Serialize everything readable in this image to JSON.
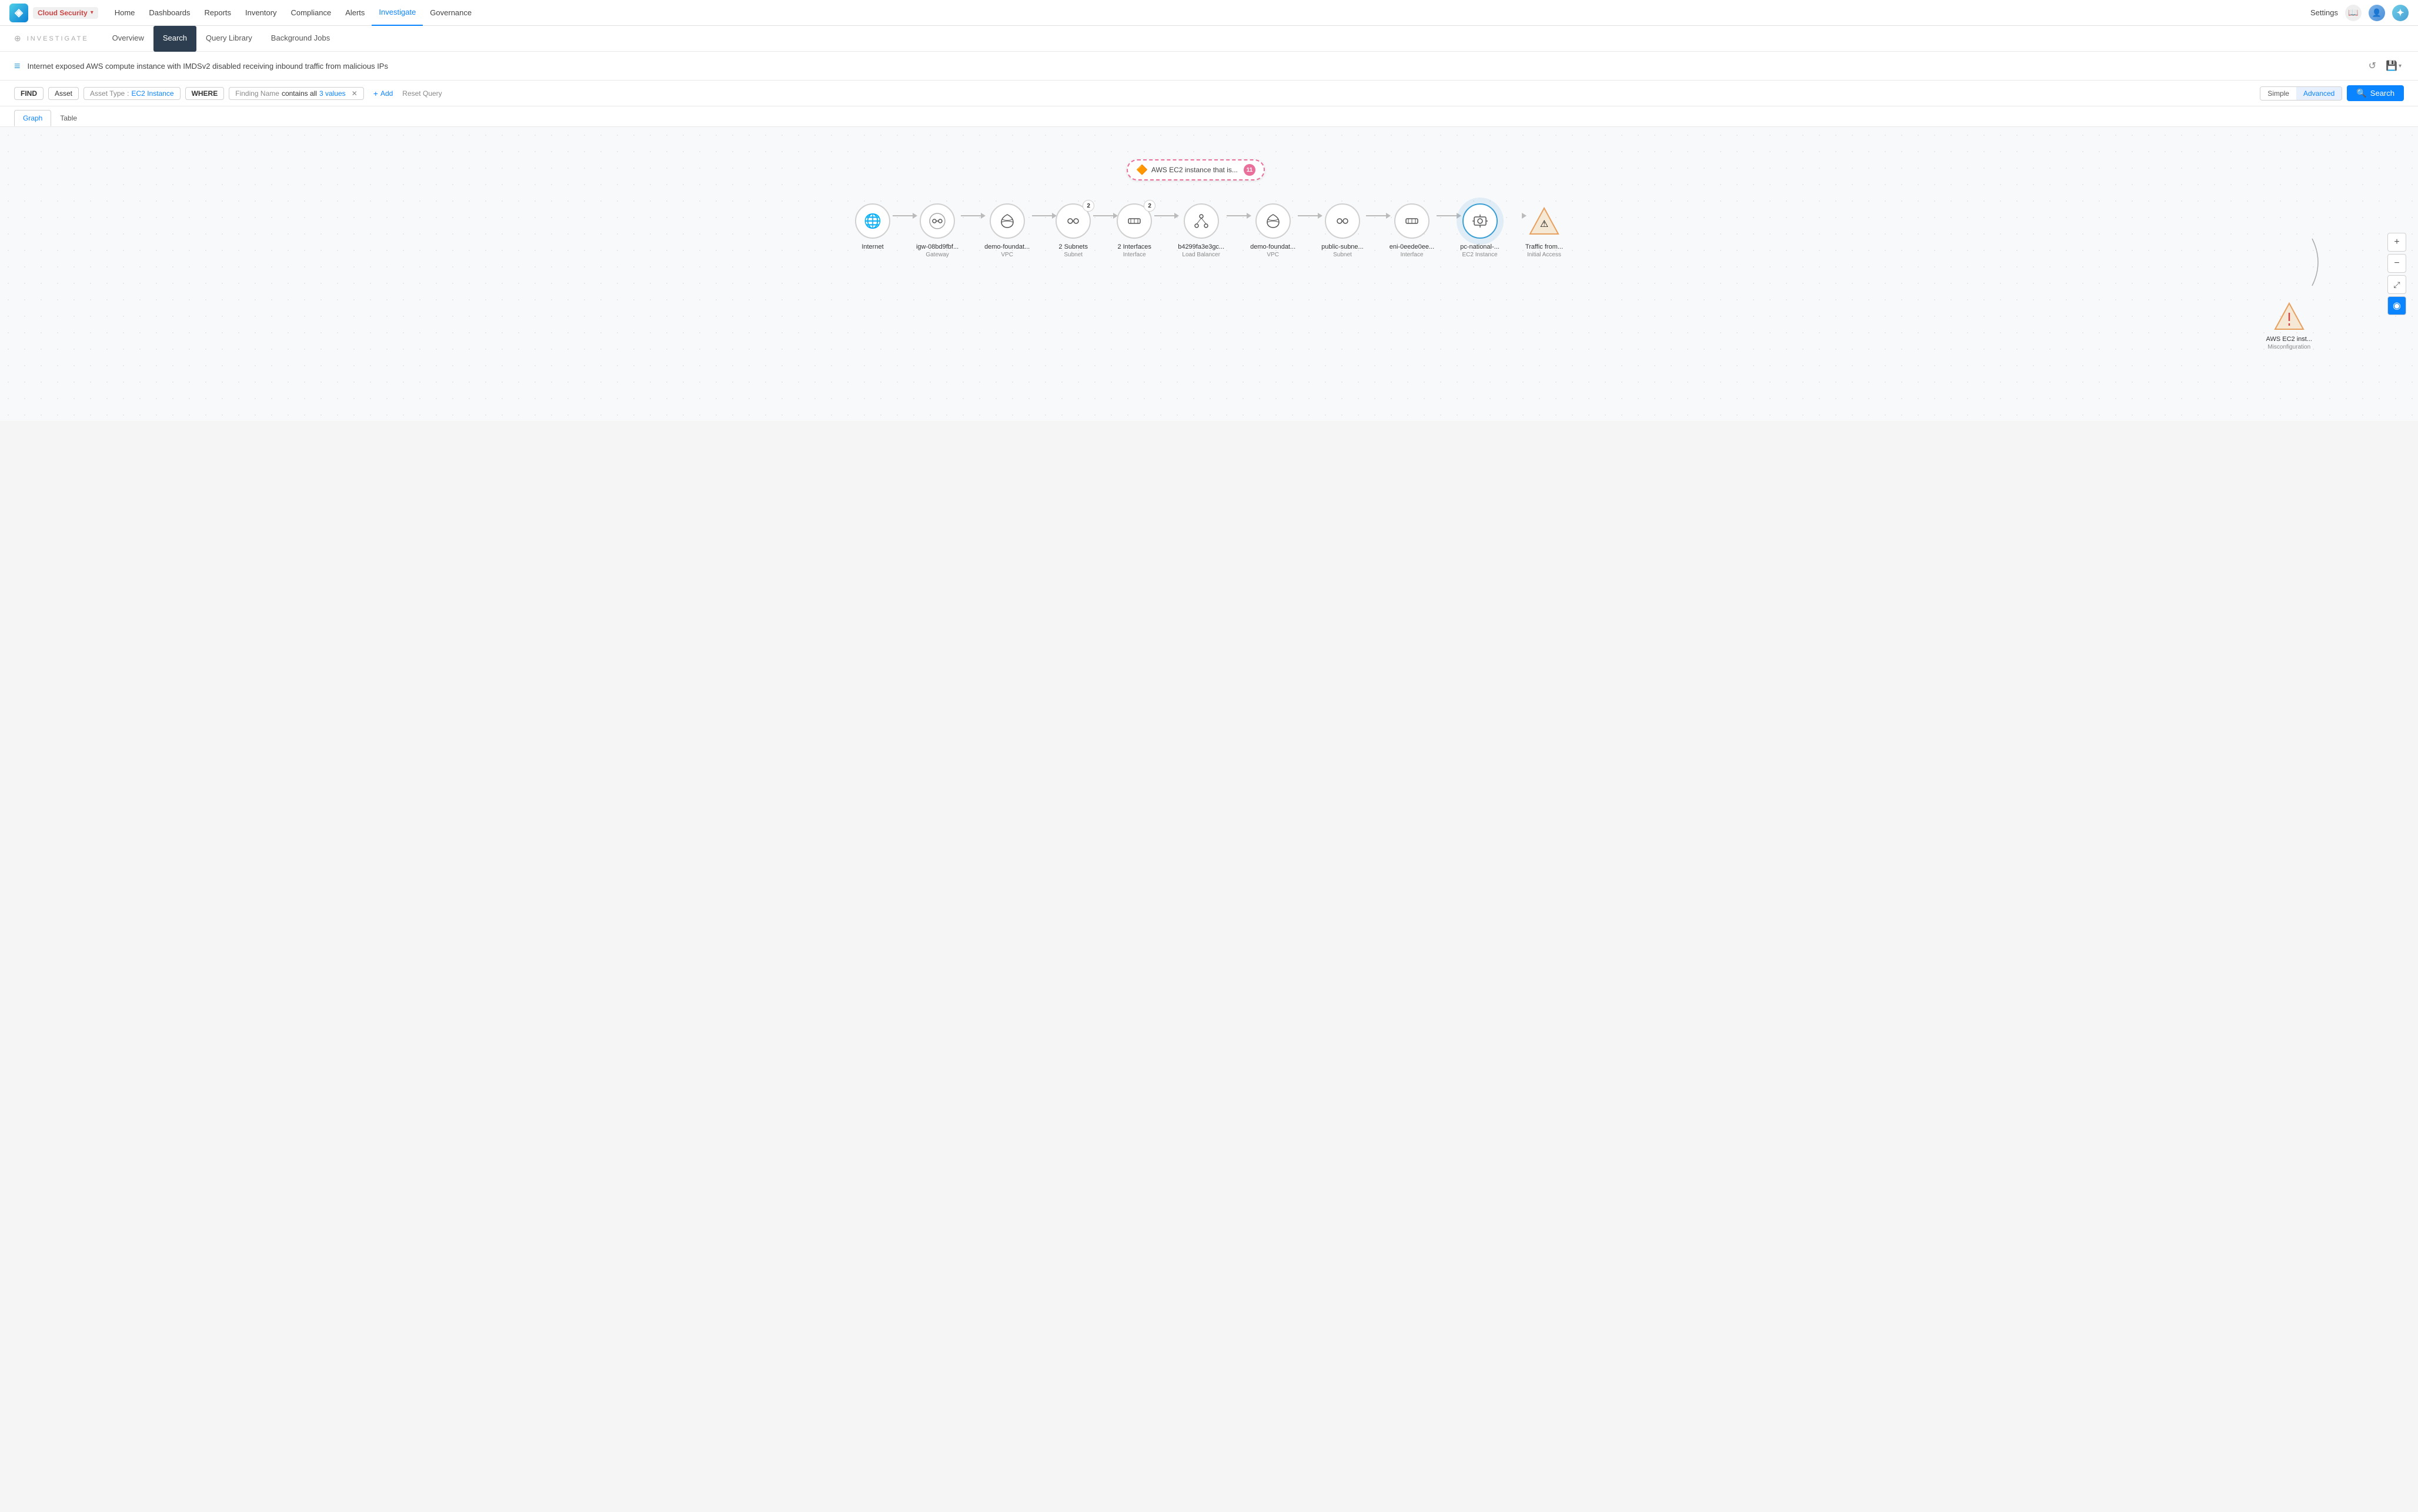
{
  "app": {
    "logo_char": "◈",
    "product": {
      "name": "Cloud Security",
      "arrow": "▾"
    }
  },
  "nav": {
    "links": [
      {
        "id": "home",
        "label": "Home",
        "active": false
      },
      {
        "id": "dashboards",
        "label": "Dashboards",
        "active": false
      },
      {
        "id": "reports",
        "label": "Reports",
        "active": false
      },
      {
        "id": "inventory",
        "label": "Inventory",
        "active": false
      },
      {
        "id": "compliance",
        "label": "Compliance",
        "active": false
      },
      {
        "id": "alerts",
        "label": "Alerts",
        "active": false
      },
      {
        "id": "investigate",
        "label": "Investigate",
        "active": true
      },
      {
        "id": "governance",
        "label": "Governance",
        "active": false
      }
    ],
    "settings": "Settings",
    "book_icon": "📖",
    "avatar_char": "👤",
    "assistant_char": "✦"
  },
  "sub_header": {
    "search_icon": "⊕",
    "title": "INVESTIGATE",
    "tabs": [
      {
        "id": "overview",
        "label": "Overview",
        "active": false
      },
      {
        "id": "search",
        "label": "Search",
        "active": true
      },
      {
        "id": "query-library",
        "label": "Query Library",
        "active": false
      },
      {
        "id": "background-jobs",
        "label": "Background Jobs",
        "active": false
      }
    ]
  },
  "query_bar": {
    "icon": "≡",
    "text": "Internet exposed AWS compute instance with IMDSv2 disabled receiving inbound traffic from malicious IPs",
    "undo_icon": "↺",
    "save_icon": "💾"
  },
  "filter_bar": {
    "find_label": "FIND",
    "asset_label": "Asset",
    "asset_type_label": "Asset Type",
    "asset_type_colon": ":",
    "asset_type_value": "EC2 Instance",
    "where_label": "WHERE",
    "finding_name_label": "Finding Name",
    "contains_all_label": "contains all",
    "values_label": "3 values",
    "close_icon": "✕",
    "add_label": "+ Add",
    "reset_label": "Reset Query",
    "simple_label": "Simple",
    "advanced_label": "Advanced",
    "search_label": "Search",
    "search_icon": "🔍"
  },
  "graph_table_tabs": {
    "tabs": [
      {
        "id": "graph",
        "label": "Graph",
        "active": true
      },
      {
        "id": "table",
        "label": "Table",
        "active": false
      }
    ]
  },
  "graph": {
    "ec2_bubble": {
      "icon": "🔶",
      "label": "AWS EC2 instance that is...",
      "count": "11"
    },
    "nodes": [
      {
        "id": "internet",
        "icon": "🌐",
        "label": "Internet",
        "sublabel": "",
        "badge": null,
        "highlighted": false
      },
      {
        "id": "gateway",
        "icon": "⋈",
        "label": "igw-08bd9fbf...",
        "sublabel": "Gateway",
        "badge": null,
        "highlighted": false
      },
      {
        "id": "vpc1",
        "icon": "☁",
        "label": "demo-foundat...",
        "sublabel": "VPC",
        "badge": null,
        "highlighted": false
      },
      {
        "id": "subnets",
        "icon": "⋈",
        "label": "2 Subnets",
        "sublabel": "Subnet",
        "badge": "2",
        "highlighted": false
      },
      {
        "id": "interfaces",
        "icon": "☁",
        "label": "2 Interfaces",
        "sublabel": "Interface",
        "badge": "2",
        "highlighted": false
      },
      {
        "id": "lb",
        "icon": "⚖",
        "label": "b4299fa3e3gc...",
        "sublabel": "Load Balancer",
        "badge": null,
        "highlighted": false
      },
      {
        "id": "vpc2",
        "icon": "☁",
        "label": "demo-foundat...",
        "sublabel": "VPC",
        "badge": null,
        "highlighted": false
      },
      {
        "id": "subnet2",
        "icon": "⋈",
        "label": "public-subne...",
        "sublabel": "Subnet",
        "badge": null,
        "highlighted": false
      },
      {
        "id": "eni",
        "icon": "☁",
        "label": "eni-0eede0ee...",
        "sublabel": "Interface",
        "badge": null,
        "highlighted": false
      },
      {
        "id": "ec2",
        "icon": "⚙",
        "label": "pc-national-...",
        "sublabel": "EC2 Instance",
        "badge": null,
        "highlighted": true
      },
      {
        "id": "traffic",
        "icon": "▲",
        "label": "Traffic from...",
        "sublabel": "Initial Access",
        "badge": null,
        "highlighted": false,
        "isTriangle": true
      }
    ],
    "misconfig_node": {
      "icon": "≡",
      "label": "AWS EC2 inst...",
      "sublabel": "Misconfiguration"
    },
    "zoom_controls": [
      {
        "id": "zoom-in",
        "icon": "+",
        "title": "Zoom in",
        "special": false
      },
      {
        "id": "zoom-out",
        "icon": "−",
        "title": "Zoom out",
        "special": false
      },
      {
        "id": "fit",
        "icon": "⤢",
        "title": "Fit view",
        "special": false
      },
      {
        "id": "globe",
        "icon": "◉",
        "title": "Globe view",
        "special": true
      }
    ]
  }
}
